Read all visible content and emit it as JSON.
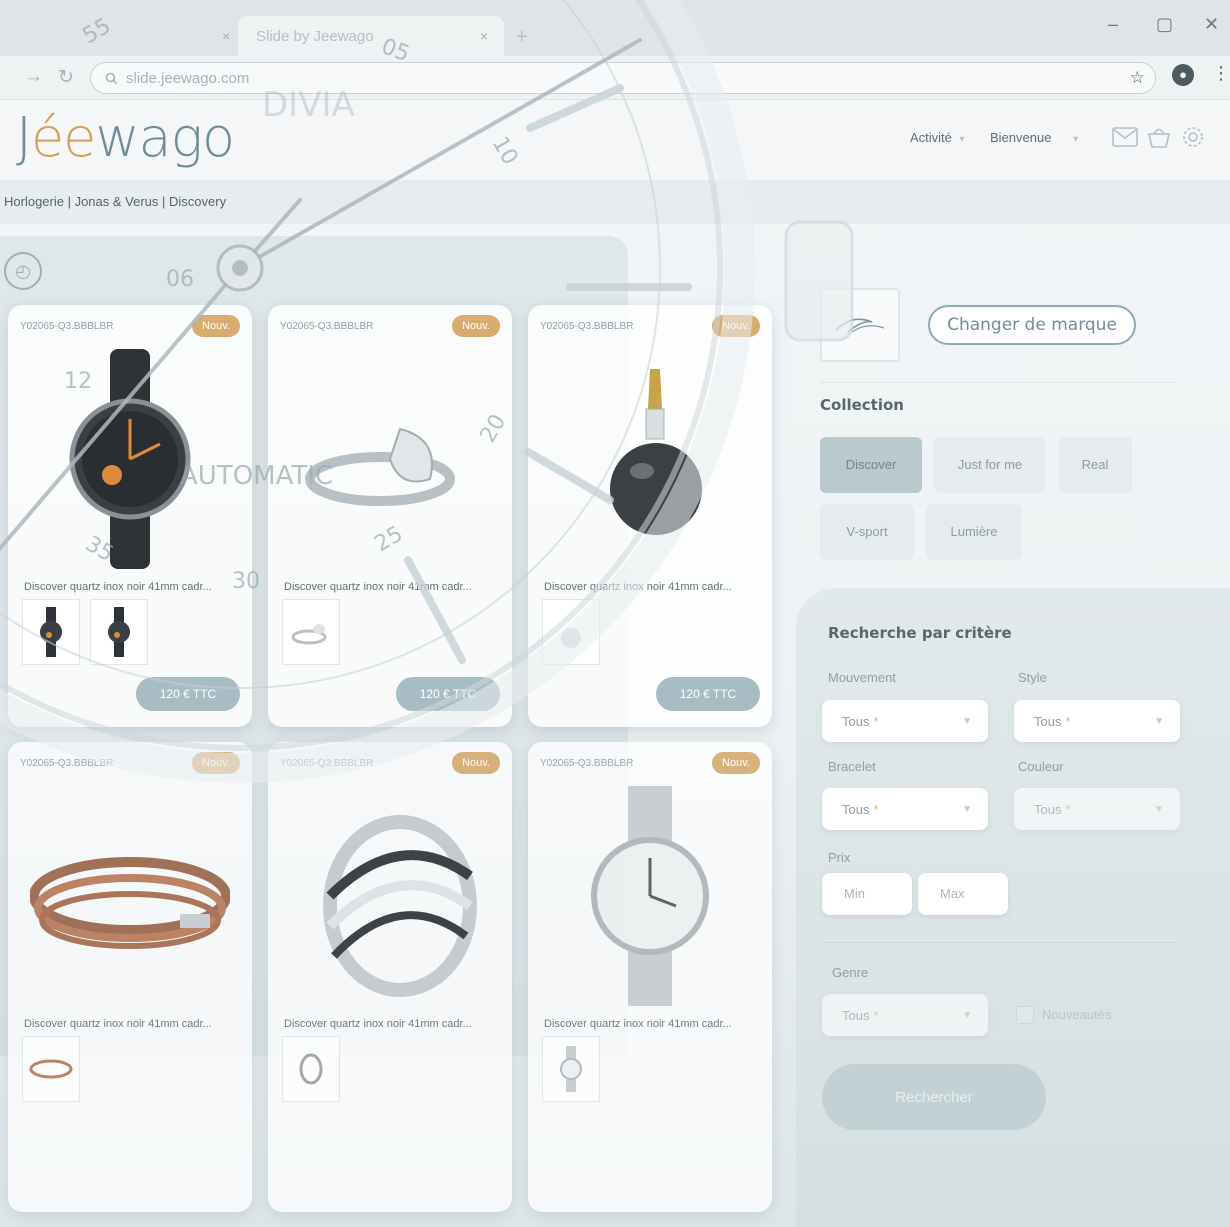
{
  "browser": {
    "tabs": [
      {
        "label": "",
        "close": "×"
      },
      {
        "label": "Slide by Jeewago",
        "close": "×"
      }
    ],
    "new_tab": "+",
    "window_controls": {
      "minimize": "–",
      "maximize": "▢",
      "close": "✕"
    },
    "nav": {
      "forward": "→",
      "reload": "↻"
    },
    "url": "slide.jeewago.com",
    "bookmark_icon": "☆",
    "account_icon": "person-icon",
    "menu_icon": "⋮"
  },
  "header": {
    "logo_text": {
      "pre": "J",
      "ring": "ée",
      "post": "wago"
    },
    "nav": [
      {
        "label": "Activité",
        "arrow": "▾"
      },
      {
        "label": "Bienvenue",
        "arrow": "▾"
      }
    ],
    "icons": [
      "mail-icon",
      "basket-icon",
      "gear-icon"
    ]
  },
  "breadcrumb": "Horlogerie | Jonas & Verus | Discovery",
  "products": [
    {
      "sku": "Y02065-Q3.BBBLBR",
      "badge": "Nouv.",
      "name": "Discover quartz inox noir 41mm cadr...",
      "price": "120 € TTC",
      "kind": "watch-black",
      "thumbs": 2
    },
    {
      "sku": "Y02065-Q3.BBBLBR",
      "badge": "Nouv.",
      "name": "Discover quartz inox noir 41mm cadr...",
      "price": "120 € TTC",
      "kind": "ring-pear",
      "thumbs": 1
    },
    {
      "sku": "Y02065-Q3.BBBLBR",
      "badge": "Nouv.",
      "name": "Discover quartz inox noir 41mm cadr...",
      "price": "120 € TTC",
      "kind": "pearl-pendant",
      "thumbs": 1
    },
    {
      "sku": "Y02065-Q3.BBBLBR",
      "badge": "Nouv.",
      "name": "Discover quartz inox noir 41mm cadr...",
      "price": "",
      "kind": "bracelet-leather",
      "thumbs": 1
    },
    {
      "sku": "Y02065-Q3.BBBLBR",
      "badge": "Nouv.",
      "name": "Discover quartz inox noir 41mm cadr...",
      "price": "",
      "kind": "ring-crossover",
      "thumbs": 1
    },
    {
      "sku": "Y02065-Q3.BBBLBR",
      "badge": "Nouv.",
      "name": "Discover quartz inox noir 41mm cadr...",
      "price": "",
      "kind": "watch-steel",
      "thumbs": 1
    }
  ],
  "brand": {
    "change_label": "Changer de marque"
  },
  "collection": {
    "title": "Collection",
    "chips": [
      {
        "label": "Discover",
        "active": true
      },
      {
        "label": "Just for me",
        "active": false
      },
      {
        "label": "Real",
        "active": false
      },
      {
        "label": "V-sport",
        "active": false
      },
      {
        "label": "Lumière",
        "active": false
      }
    ]
  },
  "search": {
    "title": "Recherche par critère",
    "fields": {
      "mouvement": {
        "label": "Mouvement",
        "value": "Tous",
        "req": "*"
      },
      "style": {
        "label": "Style",
        "value": "Tous",
        "req": "*"
      },
      "bracelet": {
        "label": "Bracelet",
        "value": "Tous",
        "req": "*"
      },
      "couleur": {
        "label": "Couleur",
        "value": "Tous",
        "req": "*"
      },
      "genre": {
        "label": "Genre",
        "value": "Tous",
        "req": "*"
      }
    },
    "price": {
      "label": "Prix",
      "min_placeholder": "Min",
      "max_placeholder": "Max"
    },
    "checkbox_label": "Nouveautés",
    "submit_label": "Rechercher"
  },
  "watch_overlay": {
    "numerals": [
      "55",
      "05",
      "10",
      "20",
      "25",
      "30",
      "35",
      "12",
      "06"
    ],
    "text": "AUTOMATIC",
    "brand_mark": "DIVIA"
  },
  "colors": {
    "accent": "#6f8e98",
    "badge": "#d8ab70",
    "price": "#a8bcc3"
  }
}
